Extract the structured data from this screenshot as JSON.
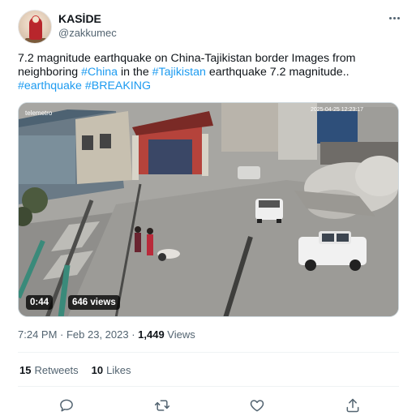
{
  "tweet": {
    "author_name": "KASİDE",
    "author_handle": "@zakkumec",
    "text_part1": "7.2 magnitude earthquake on China-Tajikistan border Images from neighboring ",
    "hashtag_china": "#China",
    "text_part2": " in the ",
    "hashtag_tajikistan": "#Tajikistan",
    "text_part3": " earthquake 7.2 magnitude..",
    "hashtag_earthquake": "#earthquake",
    "hashtag_breaking": "#BREAKING",
    "timestamp": "7:24 PM · Feb 23, 2023 · ",
    "views_count": "1,449",
    "views_label": " Views"
  },
  "media": {
    "duration": "0:44",
    "views": "646 views",
    "watermark_left": "telemetro",
    "timestamp_overlay": "2025-04-25  12:23:17"
  },
  "stats": {
    "retweets_count": "15",
    "retweets_label": "Retweets",
    "likes_count": "10",
    "likes_label": "Likes"
  },
  "icons": {
    "reply": "reply-icon",
    "retweet": "retweet-icon",
    "like": "heart-icon",
    "share": "share-icon",
    "more": "more-options-icon"
  },
  "colors": {
    "link": "#1d9bf0",
    "text": "#0f1419",
    "secondary": "#536471"
  }
}
